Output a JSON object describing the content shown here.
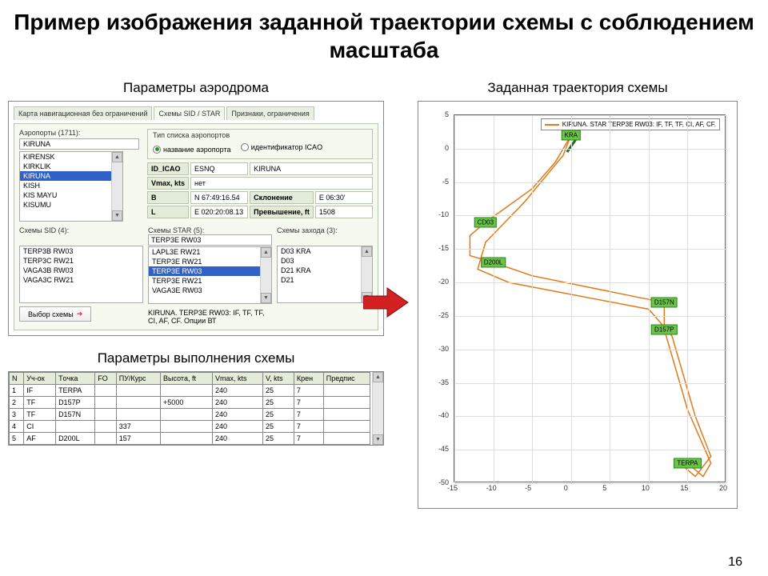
{
  "title": "Пример изображения заданной траектории схемы с соблюдением масштаба",
  "page": "16",
  "left": {
    "panel1_title": "Параметры аэродрома",
    "tabs": [
      "Карта навигационная без ограничений",
      "Схемы SID / STAR",
      "Признаки, ограничения"
    ],
    "airports_label": "Аэропорты (1711):",
    "airports": [
      "KIRUNA",
      "KIRENSK",
      "KIRKLIK",
      "KIRUNA",
      "KISH",
      "KIS MAYU",
      "KISUMU"
    ],
    "airport_selected": "KIRUNA",
    "listtype_legend": "Тип списка аэропортов",
    "radio1": "название аэропорта",
    "radio2": "идентификатор ICAO",
    "fields": {
      "id_icao_l": "ID_ICAO",
      "id_icao_v": "ESNQ",
      "name_v": "KIRUNA",
      "vmax_l": "Vmax, kts",
      "vmax_v": "нет",
      "b_l": "B",
      "b_v": "N 67:49:16.54",
      "skl_l": "Склонение",
      "skl_v": "E 06:30'",
      "l_l": "L",
      "l_v": "E 020:20:08.13",
      "prev_l": "Превышение, ft",
      "prev_v": "1508"
    },
    "scheme_sid_l": "Схемы SID (4):",
    "scheme_star_l": "Схемы STAR (5):",
    "scheme_exit_l": "Схемы захода (3):",
    "sid_list": [
      "TERP3B RW03",
      "TERP3C RW21",
      "VAGA3B RW03",
      "VAGA3C RW21"
    ],
    "star_top": "TERP3E RW03",
    "star_list": [
      "LAPL3E RW21",
      "TERP3E RW21",
      "TERP3E RW03",
      "TERP3E RW21",
      "VAGA3E RW03"
    ],
    "star_selected": "TERP3E RW03",
    "exit_list": [
      "D03   KRA",
      "D03",
      "D21   KRA",
      "D21"
    ],
    "choose_btn": "Выбор схемы",
    "bottom_line": "KIRUNA. TERP3E RW03: IF, TF, TF, CI, AF, CF. Опции ВТ",
    "panel2_title": "Параметры выполнения схемы",
    "cols": [
      "N",
      "Уч-ок",
      "Тoчка",
      "FO",
      "ПУ/Курс",
      "Высота, ft",
      "Vmax, kts",
      "V, kts",
      "Крен",
      "Предпис"
    ],
    "rows": [
      [
        "1",
        "IF",
        "TERPA",
        "",
        "",
        "",
        "240",
        "25",
        "7",
        ""
      ],
      [
        "2",
        "TF",
        "D157P",
        "",
        "",
        "+5000",
        "240",
        "25",
        "7",
        ""
      ],
      [
        "3",
        "TF",
        "D157N",
        "",
        "",
        "",
        "240",
        "25",
        "7",
        ""
      ],
      [
        "4",
        "CI",
        "",
        "",
        "337",
        "",
        "240",
        "25",
        "7",
        ""
      ],
      [
        "5",
        "AF",
        "D200L",
        "",
        "157",
        "",
        "240",
        "25",
        "7",
        ""
      ]
    ]
  },
  "right": {
    "title": "Заданная траектория схемы",
    "legend": "KIRUNA. STAR TERP3E RW03: IF, TF, TF, CI, AF, CF.",
    "y_ticks": [
      "5",
      "0",
      "-5",
      "-10",
      "-15",
      "-20",
      "-25",
      "-30",
      "-35",
      "-40",
      "-45",
      "-50"
    ],
    "x_ticks": [
      "-15",
      "-10",
      "-5",
      "0",
      "5",
      "10",
      "15",
      "20"
    ]
  },
  "chart_data": {
    "type": "line",
    "title": "Заданная траектория схемы",
    "xlabel": "",
    "ylabel": "",
    "xlim": [
      -15,
      20
    ],
    "ylim": [
      -50,
      5
    ],
    "series": [
      {
        "name": "KIRUNA. STAR TERP3E RW03: IF, TF, TF, CI, AF, CF.",
        "color": "#e07a1a"
      }
    ],
    "waypoints": [
      {
        "name": "KRA",
        "x": 0,
        "y": 2
      },
      {
        "name": "CD03",
        "x": -11,
        "y": -11
      },
      {
        "name": "D200L",
        "x": -10,
        "y": -17
      },
      {
        "name": "D157N",
        "x": 12,
        "y": -23
      },
      {
        "name": "D157P",
        "x": 12,
        "y": -27
      },
      {
        "name": "TERPA",
        "x": 15,
        "y": -47
      }
    ]
  }
}
